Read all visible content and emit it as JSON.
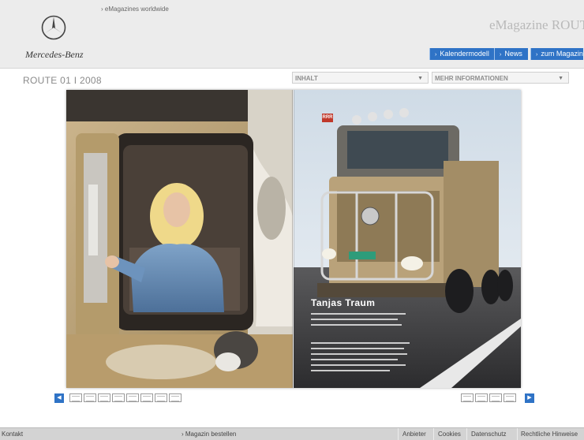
{
  "header": {
    "worldwide_link": "› eMagazines worldwide",
    "logo_text": "Mercedes-Benz",
    "brand_title": "eMagazine ROUTE",
    "nav": [
      {
        "label": "Kalendermodell"
      },
      {
        "label": "News"
      },
      {
        "label": "zum Magazin"
      }
    ]
  },
  "issue": {
    "title": "ROUTE 01 I 2008",
    "dropdown_inhalt": "INHALT",
    "dropdown_mehr": "MEHR INFORMATIONEN"
  },
  "spread": {
    "story_title": "Tanjas Traum",
    "badge": "RRR"
  },
  "footer": {
    "kontakt": "Kontakt",
    "magazin": "› Magazin bestellen",
    "anbieter": "Anbieter",
    "cookies": "Cookies",
    "datenschutz": "Datenschutz",
    "rechtliche": "Rechtliche Hinweise"
  },
  "colors": {
    "accent_blue": "#2f73c6",
    "header_bg": "#ececec",
    "footer_bg": "#d3d3d3"
  }
}
